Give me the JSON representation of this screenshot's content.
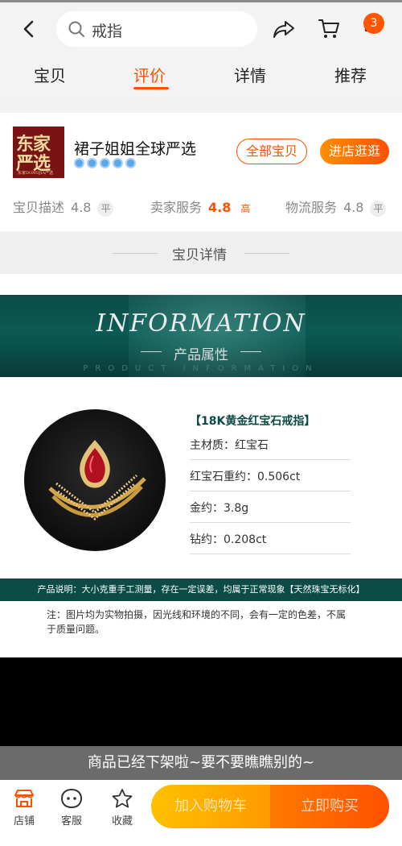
{
  "search": {
    "value": "戒指"
  },
  "cart_badge": "3",
  "tabs": [
    {
      "label": "宝贝",
      "active": false
    },
    {
      "label": "评价",
      "active": true
    },
    {
      "label": "详情",
      "active": false
    },
    {
      "label": "推荐",
      "active": false
    }
  ],
  "shop": {
    "logo_line1": "东家",
    "logo_line2": "严选",
    "logo_small": "东家DONGJIA严选",
    "name": "裙子姐姐全球严选",
    "medal_count": 5,
    "btn_all": "全部宝贝",
    "btn_enter": "进店逛逛",
    "scores": [
      {
        "label": "宝贝描述",
        "value": "4.8",
        "tag": "平",
        "high": false
      },
      {
        "label": "卖家服务",
        "value": "4.8",
        "tag": "高",
        "high": true
      },
      {
        "label": "物流服务",
        "value": "4.8",
        "tag": "平",
        "high": false
      }
    ]
  },
  "details_header": "宝贝详情",
  "banner": {
    "title": "INFORMATION",
    "subtitle": "产品属性",
    "tiny": "PRODUCT INFORMATION"
  },
  "product": {
    "title": "【18K黄金红宝石戒指】",
    "specs": [
      "主材质：红宝石",
      "红宝石重约：0.506ct",
      "金约：3.8g",
      "钻约：0.208ct"
    ],
    "note_band": "产品说明：大小克重手工测量，存在一定误差，均属于正常现象【天然珠宝无标化】",
    "note": "注：图片均为实物拍摄，因光线和环境的不同，会有一定的色差，不属于质量问题。"
  },
  "offline_message": "商品已经下架啦~要不要瞧瞧别的~",
  "bottom": {
    "store": "店铺",
    "service": "客服",
    "favorite": "收藏",
    "add_cart": "加入购物车",
    "buy_now": "立即购买"
  },
  "colors": {
    "accent": "#ff5000",
    "banner": "#0d4b46"
  }
}
